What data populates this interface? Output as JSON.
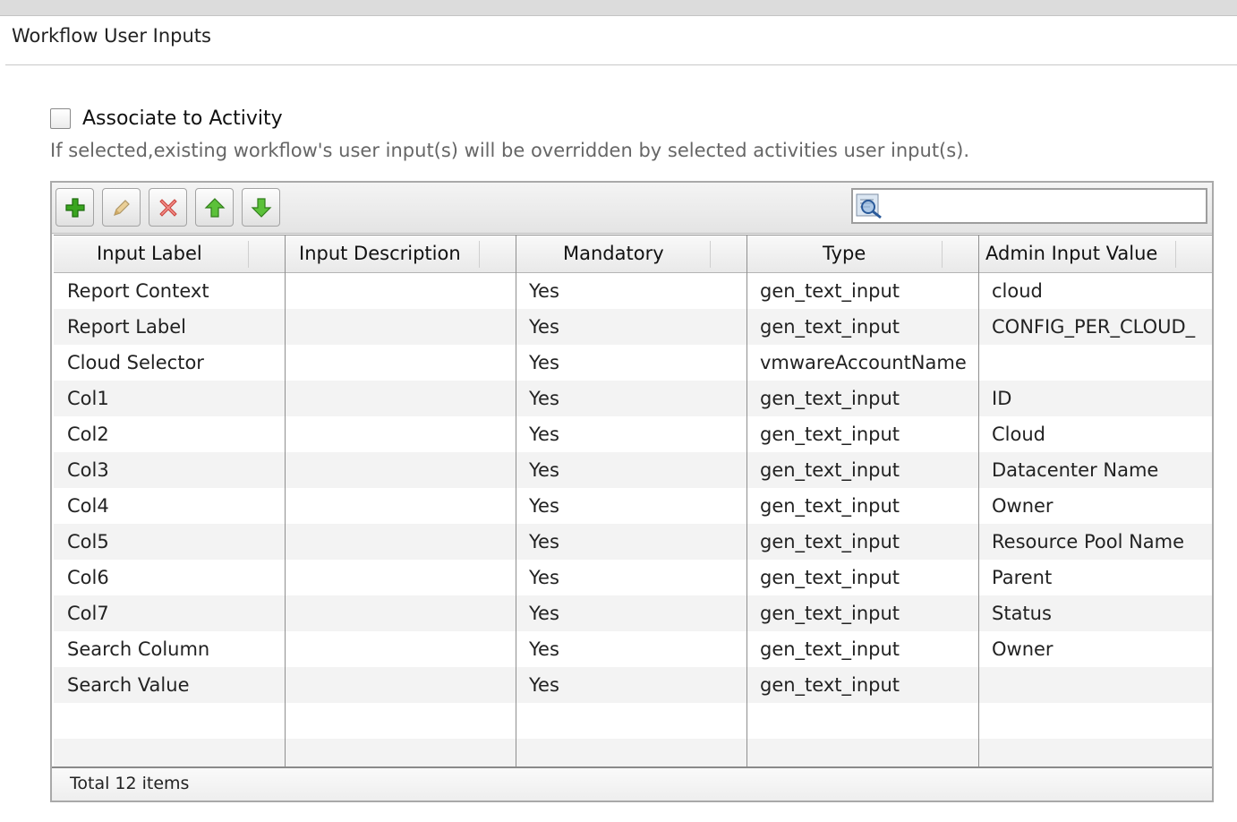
{
  "section_title": "Workflow User Inputs",
  "associate": {
    "label": "Associate to Activity",
    "checked": false,
    "help_text": "If selected,existing workflow's user input(s) will be overridden by selected activities user input(s)."
  },
  "toolbar": {
    "buttons": [
      {
        "name": "add",
        "icon": "plus-icon",
        "color": "#2f9a1c"
      },
      {
        "name": "edit",
        "icon": "pencil-icon",
        "color": "#c49a3c"
      },
      {
        "name": "delete",
        "icon": "x-icon",
        "color": "#d9534f"
      },
      {
        "name": "move-up",
        "icon": "arrow-up-icon",
        "color": "#4caf2a"
      },
      {
        "name": "move-down",
        "icon": "arrow-down-icon",
        "color": "#4caf2a"
      }
    ],
    "search": {
      "icon": "search-icon",
      "value": "",
      "placeholder": ""
    }
  },
  "table": {
    "columns": [
      "Input Label",
      "Input Description",
      "Mandatory",
      "Type",
      "Admin Input Value"
    ],
    "rows": [
      {
        "label": "Report Context",
        "description": "",
        "mandatory": "Yes",
        "type": "gen_text_input",
        "admin_value": "cloud"
      },
      {
        "label": "Report Label",
        "description": "",
        "mandatory": "Yes",
        "type": "gen_text_input",
        "admin_value": "CONFIG_PER_CLOUD_"
      },
      {
        "label": "Cloud Selector",
        "description": "",
        "mandatory": "Yes",
        "type": "vmwareAccountName",
        "admin_value": ""
      },
      {
        "label": "Col1",
        "description": "",
        "mandatory": "Yes",
        "type": "gen_text_input",
        "admin_value": "ID"
      },
      {
        "label": "Col2",
        "description": "",
        "mandatory": "Yes",
        "type": "gen_text_input",
        "admin_value": "Cloud"
      },
      {
        "label": "Col3",
        "description": "",
        "mandatory": "Yes",
        "type": "gen_text_input",
        "admin_value": "Datacenter Name"
      },
      {
        "label": "Col4",
        "description": "",
        "mandatory": "Yes",
        "type": "gen_text_input",
        "admin_value": "Owner"
      },
      {
        "label": "Col5",
        "description": "",
        "mandatory": "Yes",
        "type": "gen_text_input",
        "admin_value": "Resource Pool Name"
      },
      {
        "label": "Col6",
        "description": "",
        "mandatory": "Yes",
        "type": "gen_text_input",
        "admin_value": "Parent"
      },
      {
        "label": "Col7",
        "description": "",
        "mandatory": "Yes",
        "type": "gen_text_input",
        "admin_value": "Status"
      },
      {
        "label": "Search Column",
        "description": "",
        "mandatory": "Yes",
        "type": "gen_text_input",
        "admin_value": "Owner"
      },
      {
        "label": "Search Value",
        "description": "",
        "mandatory": "Yes",
        "type": "gen_text_input",
        "admin_value": ""
      }
    ],
    "footer": "Total 12 items"
  }
}
